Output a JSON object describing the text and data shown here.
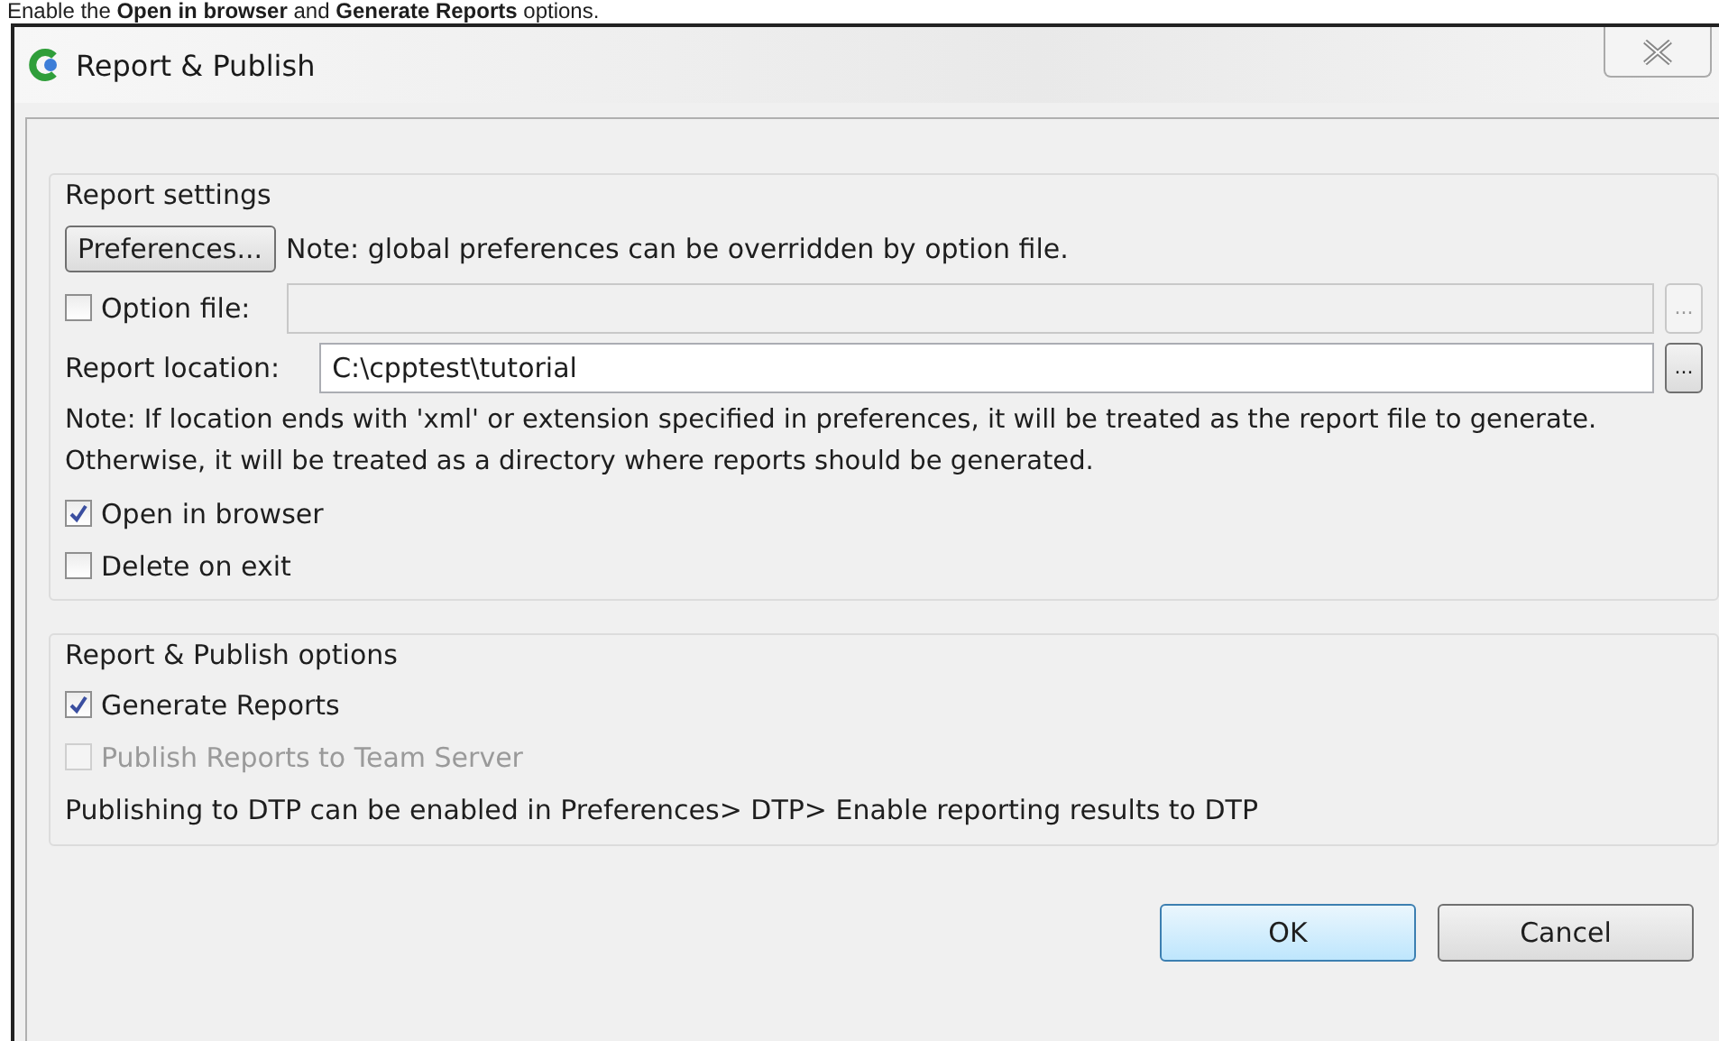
{
  "caption": "Enable the **Open in browser** and **Generate Reports** options.",
  "window": {
    "title": "Report & Publish"
  },
  "report_settings": {
    "title": "Report settings",
    "preferences_button": "Preferences...",
    "preferences_note": "Note: global preferences can be overridden by option file.",
    "option_file": {
      "label": "Option file:",
      "checked": false,
      "browse": "..."
    },
    "location": {
      "label": "Report location:",
      "value": "C:\\cpptest\\tutorial",
      "browse": "..."
    },
    "location_note": "Note: If location ends with 'xml' or extension specified in preferences, it will be treated as the report file to generate. Otherwise, it will be treated as a directory where reports should be generated.",
    "options": [
      {
        "label": "Open in browser",
        "checked": true,
        "disabled": false
      },
      {
        "label": "Delete on exit",
        "checked": false,
        "disabled": false
      }
    ]
  },
  "publish_options": {
    "title": "Report & Publish options",
    "options": [
      {
        "label": "Generate Reports",
        "checked": true,
        "disabled": false
      },
      {
        "label": "Publish Reports to Team Server",
        "checked": false,
        "disabled": true
      }
    ],
    "note": "Publishing to DTP can be enabled in Preferences> DTP> Enable reporting results to DTP"
  },
  "buttons": [
    {
      "label": "OK",
      "default": true
    },
    {
      "label": "Cancel",
      "default": false
    }
  ]
}
